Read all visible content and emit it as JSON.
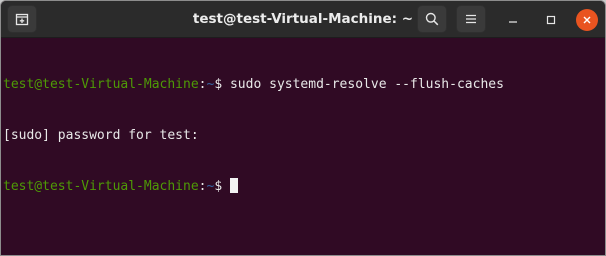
{
  "window": {
    "title": "test@test-Virtual-Machine: ~"
  },
  "titlebar": {
    "new_tab_icon": "new-tab-icon",
    "search_icon": "search-icon",
    "menu_icon": "hamburger-menu-icon",
    "minimize_icon": "minimize-icon",
    "maximize_icon": "maximize-icon",
    "close_icon": "close-icon",
    "close_color": "#e95420"
  },
  "terminal": {
    "background": "#300a24",
    "user_color": "#4e9a06",
    "path_color": "#3465a4",
    "lines": [
      {
        "user_host": "test@test-Virtual-Machine",
        "colon": ":",
        "path": "~",
        "prompt": "$ ",
        "command": "sudo systemd-resolve --flush-caches"
      },
      {
        "output": "[sudo] password for test:"
      },
      {
        "user_host": "test@test-Virtual-Machine",
        "colon": ":",
        "path": "~",
        "prompt": "$ "
      }
    ]
  }
}
